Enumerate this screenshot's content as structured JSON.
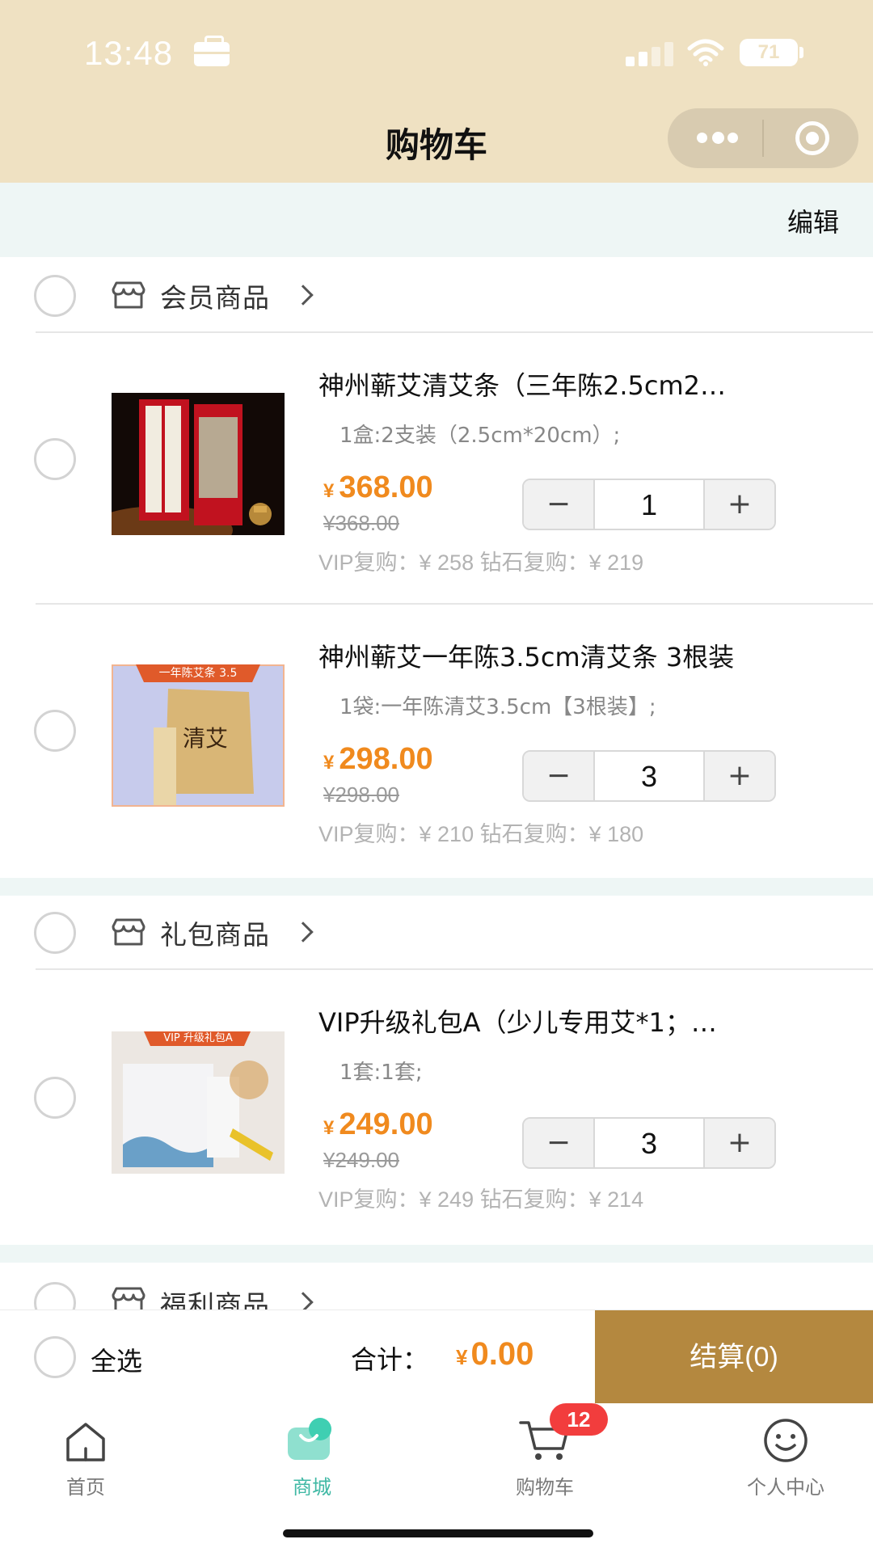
{
  "status_bar": {
    "time": "13:48",
    "battery": "71"
  },
  "nav": {
    "title": "购物车"
  },
  "toolbar": {
    "edit_label": "编辑"
  },
  "groups": [
    {
      "name": "会员商品",
      "items": [
        {
          "title": "神州蕲艾清艾条（三年陈2.5cm2…",
          "spec": "1盒:2支装（2.5cm*20cm）;",
          "price_symbol": "¥",
          "price": "368.00",
          "original_price": "¥368.00",
          "vip": "VIP复购：¥ 258  钻石复购：¥ 219",
          "qty": "1",
          "thumb_label": ""
        },
        {
          "title": "神州蕲艾一年陈3.5cm清艾条 3根装",
          "spec": "1袋:一年陈清艾3.5cm【3根装】;",
          "price_symbol": "¥",
          "price": "298.00",
          "original_price": "¥298.00",
          "vip": "VIP复购：¥ 210  钻石复购：¥ 180",
          "qty": "3",
          "thumb_label": "一年陈艾条 3.5",
          "thumb_text": "清艾"
        }
      ]
    },
    {
      "name": "礼包商品",
      "items": [
        {
          "title": "VIP升级礼包A（少儿专用艾*1；…",
          "spec": "1套:1套;",
          "price_symbol": "¥",
          "price": "249.00",
          "original_price": "¥249.00",
          "vip": "VIP复购：¥ 249  钻石复购：¥ 214",
          "qty": "3",
          "thumb_label": "VIP 升级礼包A"
        }
      ]
    },
    {
      "name": "福利商品",
      "items": []
    }
  ],
  "stepper": {
    "minus": "−",
    "plus": "+"
  },
  "checkout": {
    "select_all": "全选",
    "total_label": "合计：",
    "total_symbol": "¥",
    "total_value": "0.00",
    "settle_label": "结算(0)"
  },
  "tabbar": {
    "items": [
      {
        "label": "首页",
        "icon": "home-icon"
      },
      {
        "label": "商城",
        "icon": "mall-icon"
      },
      {
        "label": "购物车",
        "icon": "cart-icon"
      },
      {
        "label": "个人中心",
        "icon": "smiley-icon"
      }
    ],
    "active": "商城",
    "cart_badge": "12"
  },
  "colors": {
    "header_bg": "#efe1c2",
    "section_bg": "#eef6f5",
    "price": "#f08a1e",
    "settle_bg": "#b4883f",
    "active_tab": "#3fb8a4",
    "badge": "#f23d3d"
  }
}
